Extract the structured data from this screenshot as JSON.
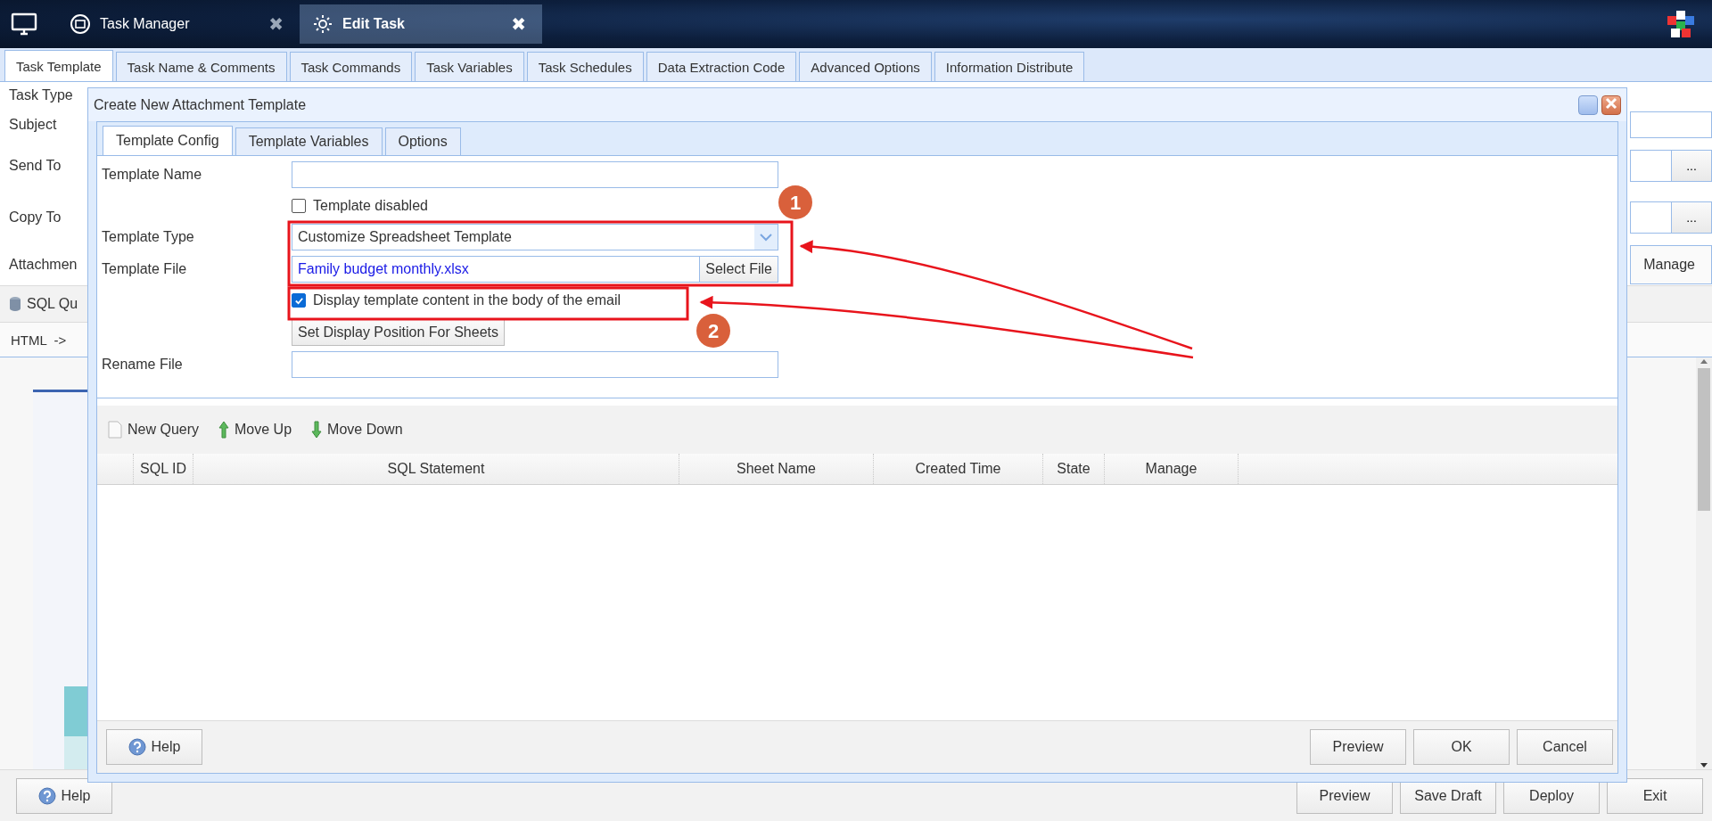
{
  "top_bar": {
    "tabs": [
      {
        "label": "Task Manager",
        "selected": false,
        "close": "✖"
      },
      {
        "label": "Edit Task",
        "selected": true,
        "close": "✖"
      }
    ]
  },
  "page_tabs": [
    {
      "label": "Task Template",
      "selected": true
    },
    {
      "label": "Task Name & Comments",
      "selected": false
    },
    {
      "label": "Task Commands",
      "selected": false
    },
    {
      "label": "Task Variables",
      "selected": false
    },
    {
      "label": "Task Schedules",
      "selected": false
    },
    {
      "label": "Data Extraction Code",
      "selected": false
    },
    {
      "label": "Advanced Options",
      "selected": false
    },
    {
      "label": "Information Distribute",
      "selected": false
    }
  ],
  "form": {
    "rows": [
      {
        "label": "Task Type",
        "kind": "plain"
      },
      {
        "label": "Subject",
        "kind": "input"
      },
      {
        "label": "Send To",
        "kind": "picker",
        "button": "..."
      },
      {
        "label": "Copy To",
        "kind": "picker",
        "button": "..."
      },
      {
        "label": "Attachmen",
        "kind": "manage",
        "button": "Manage"
      }
    ]
  },
  "sql_toolbar": {
    "label": "SQL Qu"
  },
  "html_bar": {
    "label": "HTML  ->"
  },
  "footer": {
    "help": "Help",
    "buttons": [
      "Preview",
      "Save Draft",
      "Deploy",
      "Exit"
    ]
  },
  "dialog": {
    "title": "Create New Attachment Template",
    "tabs": [
      {
        "label": "Template Config",
        "selected": true
      },
      {
        "label": "Template Variables",
        "selected": false
      },
      {
        "label": "Options",
        "selected": false
      }
    ],
    "fields": [
      {
        "kind": "text",
        "label": "Template Name"
      },
      {
        "kind": "checkbox",
        "label": "Template disabled",
        "checked": false
      },
      {
        "kind": "select",
        "label": "Template Type",
        "value": "Customize Spreadsheet Template"
      },
      {
        "kind": "file",
        "label": "Template File",
        "value": "Family budget monthly.xlsx",
        "button": "Select File"
      },
      {
        "kind": "checkbox",
        "label": "Display template content in the body of the email",
        "checked": true
      },
      {
        "kind": "button",
        "label": "Set Display Position For Sheets"
      },
      {
        "kind": "text",
        "label": "Rename File"
      }
    ],
    "toolbar": [
      {
        "kind": "new",
        "label": "New Query"
      },
      {
        "kind": "up",
        "label": "Move Up"
      },
      {
        "kind": "down",
        "label": "Move Down"
      }
    ],
    "table": {
      "columns": [
        "SQL ID",
        "SQL Statement",
        "Sheet Name",
        "Created Time",
        "State",
        "Manage"
      ]
    },
    "footer": {
      "help": "Help",
      "buttons": [
        "Preview",
        "OK",
        "Cancel"
      ]
    }
  },
  "annotations": [
    {
      "number": "1"
    },
    {
      "number": "2"
    }
  ]
}
